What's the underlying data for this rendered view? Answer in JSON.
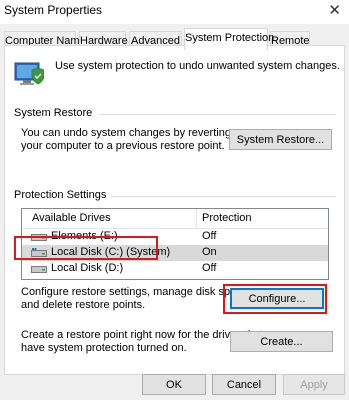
{
  "window": {
    "title": "System Properties",
    "close_glyph": "✕"
  },
  "tabs": [
    {
      "label": "Computer Name",
      "active": false
    },
    {
      "label": "Hardware",
      "active": false
    },
    {
      "label": "Advanced",
      "active": false
    },
    {
      "label": "System Protection",
      "active": true
    },
    {
      "label": "Remote",
      "active": false
    }
  ],
  "intro": {
    "icon": "system-protection-icon",
    "text": "Use system protection to undo unwanted system changes."
  },
  "system_restore": {
    "group_label": "System Restore",
    "description": [
      "You can undo system changes by reverting",
      "your computer to a previous restore point."
    ],
    "button_label": "System Restore..."
  },
  "protection_settings": {
    "group_label": "Protection Settings",
    "columns": [
      "Available Drives",
      "Protection"
    ],
    "drives": [
      {
        "name": "Elements (E:)",
        "protection": "Off",
        "icon": "drive-icon",
        "selected": false
      },
      {
        "name": "Local Disk (C:) (System)",
        "protection": "On",
        "icon": "system-drive-icon",
        "selected": true
      },
      {
        "name": "Local Disk (D:)",
        "protection": "Off",
        "icon": "drive-icon",
        "selected": false
      }
    ],
    "configure_text": [
      "Configure restore settings, manage disk space,",
      "and delete restore points."
    ],
    "configure_label": "Configure...",
    "create_text": [
      "Create a restore point right now for the drives that",
      "have system protection turned on."
    ],
    "create_label": "Create..."
  },
  "footer": {
    "ok": "OK",
    "cancel": "Cancel",
    "apply": "Apply"
  },
  "colors": {
    "highlight_box": "#e0161c",
    "focus_border": "#0078d7",
    "selected_row": "#d9d9d9"
  }
}
